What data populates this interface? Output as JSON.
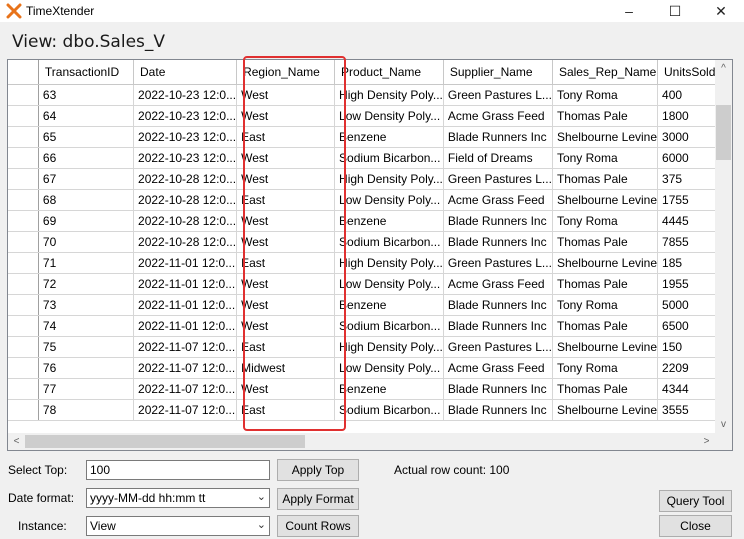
{
  "window": {
    "title": "TimeXtender",
    "controls": [
      "–",
      "☐",
      "✕"
    ]
  },
  "view_title": "View: dbo.Sales_V",
  "grid": {
    "columns": [
      "TransactionID",
      "Date",
      "Region_Name",
      "Product_Name",
      "Supplier_Name",
      "Sales_Rep_Name",
      "UnitsSold"
    ],
    "rows": [
      [
        "63",
        "2022-10-23 12:0...",
        "West",
        "High Density Poly...",
        "Green Pastures L...",
        "Tony Roma",
        "400"
      ],
      [
        "64",
        "2022-10-23 12:0...",
        "West",
        "Low Density Poly...",
        "Acme Grass Feed",
        "Thomas Pale",
        "1800"
      ],
      [
        "65",
        "2022-10-23 12:0...",
        "East",
        "Benzene",
        "Blade Runners Inc",
        "Shelbourne Levine",
        "3000"
      ],
      [
        "66",
        "2022-10-23 12:0...",
        "West",
        "Sodium Bicarbon...",
        "Field of Dreams",
        "Tony Roma",
        "6000"
      ],
      [
        "67",
        "2022-10-28 12:0...",
        "West",
        "High Density Poly...",
        "Green Pastures L...",
        "Thomas Pale",
        "375"
      ],
      [
        "68",
        "2022-10-28 12:0...",
        "East",
        "Low Density Poly...",
        "Acme Grass Feed",
        "Shelbourne Levine",
        "1755"
      ],
      [
        "69",
        "2022-10-28 12:0...",
        "West",
        "Benzene",
        "Blade Runners Inc",
        "Tony Roma",
        "4445"
      ],
      [
        "70",
        "2022-10-28 12:0...",
        "West",
        "Sodium Bicarbon...",
        "Blade Runners Inc",
        "Thomas Pale",
        "7855"
      ],
      [
        "71",
        "2022-11-01 12:0...",
        "East",
        "High Density Poly...",
        "Green Pastures L...",
        "Shelbourne Levine",
        "185"
      ],
      [
        "72",
        "2022-11-01 12:0...",
        "West",
        "Low Density Poly...",
        "Acme Grass Feed",
        "Thomas Pale",
        "1955"
      ],
      [
        "73",
        "2022-11-01 12:0...",
        "West",
        "Benzene",
        "Blade Runners Inc",
        "Tony Roma",
        "5000"
      ],
      [
        "74",
        "2022-11-01 12:0...",
        "West",
        "Sodium Bicarbon...",
        "Blade Runners Inc",
        "Thomas Pale",
        "6500"
      ],
      [
        "75",
        "2022-11-07 12:0...",
        "East",
        "High Density Poly...",
        "Green Pastures L...",
        "Shelbourne Levine",
        "150"
      ],
      [
        "76",
        "2022-11-07 12:0...",
        "Midwest",
        "Low Density Poly...",
        "Acme Grass Feed",
        "Tony Roma",
        "2209"
      ],
      [
        "77",
        "2022-11-07 12:0...",
        "West",
        "Benzene",
        "Blade Runners Inc",
        "Thomas Pale",
        "4344"
      ],
      [
        "78",
        "2022-11-07 12:0...",
        "East",
        "Sodium Bicarbon...",
        "Blade Runners Inc",
        "Shelbourne Levine",
        "3555"
      ]
    ]
  },
  "controls": {
    "select_top_label": "Select Top:",
    "select_top_value": "100",
    "apply_top": "Apply Top",
    "row_count": "Actual row count: 100",
    "date_format_label": "Date format:",
    "date_format_value": "yyyy-MM-dd hh:mm tt",
    "apply_format": "Apply Format",
    "instance_label": "Instance:",
    "instance_value": "View",
    "count_rows": "Count Rows",
    "query_tool": "Query Tool",
    "close": "Close"
  },
  "colors": {
    "accent": "#e8731a",
    "highlight": "#e03030"
  }
}
